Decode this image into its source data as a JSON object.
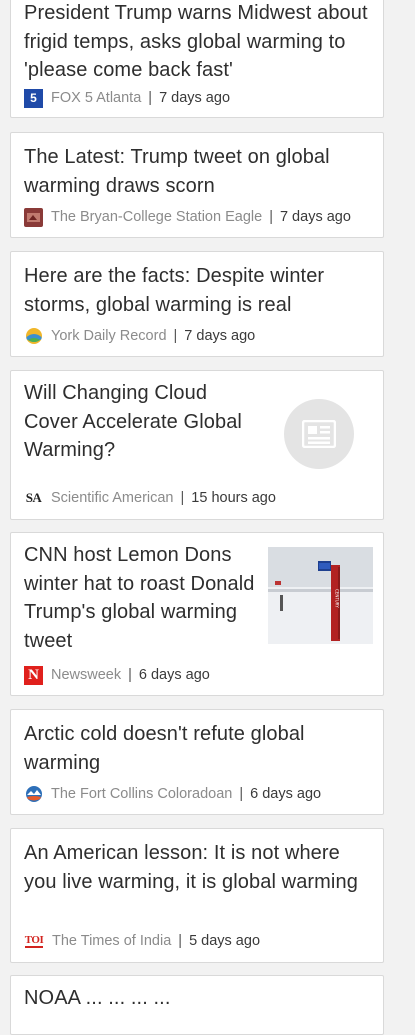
{
  "articles": [
    {
      "headline": "President Trump warns Midwest about frigid temps, asks global warming to 'please come back fast'",
      "source": "FOX 5 Atlanta",
      "age": "7 days ago",
      "logo": "fox5-logo",
      "logo_text": "FOX 5"
    },
    {
      "headline": "The Latest: Trump tweet on global warming draws scorn",
      "source": "The Bryan-College Station Eagle",
      "age": "7 days ago",
      "logo": "eagle-logo"
    },
    {
      "headline": "Here are the facts: Despite winter storms, global warming is real",
      "source": "York Daily Record",
      "age": "7 days ago",
      "logo": "york-daily-record-logo"
    },
    {
      "headline": "Will Changing Cloud Cover Accelerate Global Warming?",
      "source": "Scientific American",
      "age": "15 hours ago",
      "logo": "sa-logo",
      "logo_text": "SA",
      "thumbnail": "newspaper-icon"
    },
    {
      "headline": "CNN host Lemon Dons winter hat to roast Donald Trump's global warming tweet",
      "source": "Newsweek",
      "age": "6 days ago",
      "logo": "newsweek-logo",
      "logo_text": "N",
      "thumbnail": "snowy-sign-photo"
    },
    {
      "headline": "Arctic cold doesn't refute global warming",
      "source": "The Fort Collins Coloradoan",
      "age": "6 days ago",
      "logo": "coloradoan-logo"
    },
    {
      "headline": "An American lesson: It is not where you live warming, it is global warming",
      "source": "The Times of India",
      "age": "5 days ago",
      "logo": "toi-logo",
      "logo_text": "TOI"
    },
    {
      "headline": "NOAA ... ... ... ...",
      "source": "",
      "age": ""
    }
  ],
  "separator": "|",
  "colors": {
    "background": "#f2f2f2",
    "card": "#ffffff",
    "border": "#d9d9d9",
    "fox_blue": "#1f4aa8",
    "newsweek_red": "#e0201c",
    "toi_red": "#d2231e"
  }
}
